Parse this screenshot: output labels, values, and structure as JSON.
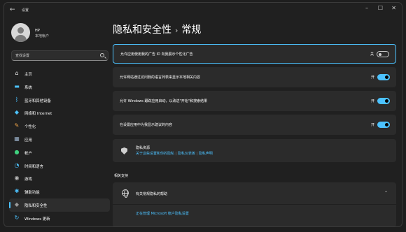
{
  "window": {
    "title": "设置",
    "back_icon": "←",
    "minimize_icon": "–",
    "maximize_icon": "☐",
    "close_icon": "✕"
  },
  "user": {
    "name": "HP",
    "account_type": "本地帐户"
  },
  "search": {
    "placeholder": "查找设置"
  },
  "sidebar": {
    "items": [
      {
        "label": "主页",
        "icon": "home-icon",
        "color": "#e8e8e8",
        "glyph": "⌂"
      },
      {
        "label": "系统",
        "icon": "monitor-icon",
        "color": "#4cc2ff",
        "glyph": "▬"
      },
      {
        "label": "蓝牙和其他设备",
        "icon": "bluetooth-icon",
        "color": "#4cc2ff",
        "glyph": "ᛒ"
      },
      {
        "label": "网络和 Internet",
        "icon": "wifi-icon",
        "color": "#4cc2ff",
        "glyph": "◆"
      },
      {
        "label": "个性化",
        "icon": "brush-icon",
        "color": "#f7a94a",
        "glyph": "✎"
      },
      {
        "label": "应用",
        "icon": "apps-icon",
        "color": "#9ab0c8",
        "glyph": "▦"
      },
      {
        "label": "帐户",
        "icon": "account-icon",
        "color": "#3fd17e",
        "glyph": "●"
      },
      {
        "label": "时间和语言",
        "icon": "clock-globe-icon",
        "color": "#4cc2ff",
        "glyph": "◔"
      },
      {
        "label": "游戏",
        "icon": "controller-icon",
        "color": "#b8b8b8",
        "glyph": "◉"
      },
      {
        "label": "辅助功能",
        "icon": "accessibility-icon",
        "color": "#4cc2ff",
        "glyph": "✱"
      },
      {
        "label": "隐私和安全性",
        "icon": "shield-icon",
        "color": "#9a9a9a",
        "glyph": "◆"
      },
      {
        "label": "Windows 更新",
        "icon": "update-icon",
        "color": "#4cc2ff",
        "glyph": "↻"
      }
    ],
    "active_index": 10
  },
  "header": {
    "section": "隐私和安全性",
    "separator": "›",
    "page": "常规"
  },
  "settings": [
    {
      "text": "允许应用使用我的广告 ID 向我展示个性化广告",
      "state": "关",
      "on": false
    },
    {
      "text": "允许网站通过访问我的语言列表来显示本地相关内容",
      "state": "开",
      "on": true
    },
    {
      "text": "允许 Windows 跟踪应用启动，以改进\"开始\"和搜索结果",
      "state": "开",
      "on": true
    },
    {
      "text": "在设置应用中为我显示建议的内容",
      "state": "开",
      "on": true
    }
  ],
  "privacy_resources": {
    "title": "隐私资源",
    "link_1": "关于这些设置和你的隐私",
    "separator": "|",
    "link_2": "隐私仪表板",
    "link_3": "隐私声明"
  },
  "related": {
    "label": "相关支持",
    "help_title": "有关常规隐私的帮助",
    "help_link": "正在管理 Microsoft 帐户隐私设置"
  },
  "colors": {
    "accent": "#4cc2ff",
    "card": "#2b2b2b",
    "background": "#202020"
  }
}
